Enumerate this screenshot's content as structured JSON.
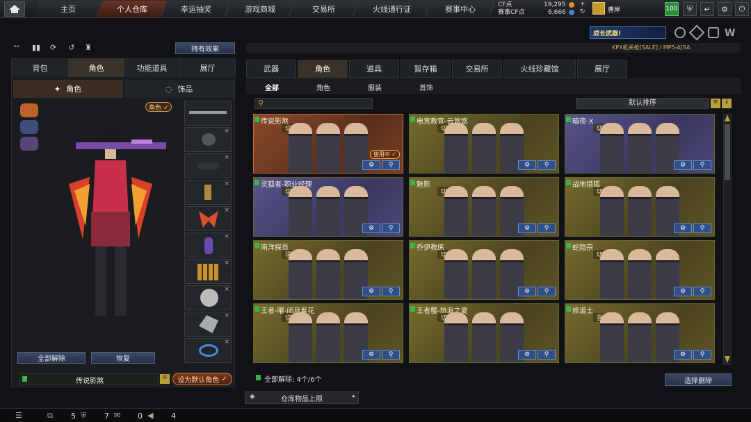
{
  "nav": {
    "tabs": [
      "主页",
      "个人仓库",
      "幸运抽奖",
      "游戏商城",
      "交易所",
      "火线通行证",
      "赛事中心"
    ],
    "active": 1
  },
  "currency": {
    "cf_label": "CF点",
    "cf_value": "19,295",
    "match_label": "赛事CF点",
    "match_value": "6,666",
    "user": "曹岸",
    "level": "100"
  },
  "banner": {
    "text": "成长武器!",
    "ticker": "KPX机关枪[SALE] / MP5-A[SA"
  },
  "left": {
    "effect_button": "持有效果",
    "tabs": [
      "背包",
      "角色",
      "功能道具",
      "展厅"
    ],
    "subtabs": [
      "角色",
      "饰品"
    ],
    "role_badge": "角色",
    "release_all": "全部解除",
    "restore": "恢复",
    "current_name": "传说影煞",
    "set_default": "设为默认角色"
  },
  "right": {
    "tabs": [
      "武器",
      "角色",
      "道具",
      "暂存箱",
      "交易所",
      "火线珍藏馆",
      "展厅"
    ],
    "subtabs": [
      "全部",
      "角色",
      "服装",
      "首饰"
    ],
    "sort": "默认排序",
    "cards": [
      {
        "title": "传说影煞",
        "tag": "切换型",
        "style": "orange",
        "inuse": "使用中"
      },
      {
        "title": "电竞教官-云悠悠",
        "tag": "切换型",
        "style": "gold"
      },
      {
        "title": "暗夜-X",
        "tag": "切换型",
        "style": "purple"
      },
      {
        "title": "灵狐者-职业经理",
        "tag": "切换型",
        "style": "purple"
      },
      {
        "title": "魅影",
        "tag": "切换型",
        "style": "gold"
      },
      {
        "title": "战地猎狐",
        "tag": "切换型",
        "style": "gold"
      },
      {
        "title": "南洋探员",
        "tag": "强化型",
        "style": "gold"
      },
      {
        "title": "乔伊教练",
        "tag": "切换型",
        "style": "gold"
      },
      {
        "title": "蛇隐宗",
        "tag": "切换型",
        "style": "gold"
      },
      {
        "title": "王者-曜-闭月羞花",
        "tag": "切换型",
        "style": "gold"
      },
      {
        "title": "王者樱-热浪之夏",
        "tag": "切换型",
        "style": "gold"
      },
      {
        "title": "修道士",
        "tag": "强化型",
        "style": "gold"
      }
    ],
    "release_count": "全部解除: 4个/6个",
    "select_delete": "选择删除",
    "warehouse_limit": "仓库物品上限"
  },
  "status": {
    "a": "5",
    "b": "7",
    "c": "0",
    "d": "4"
  }
}
